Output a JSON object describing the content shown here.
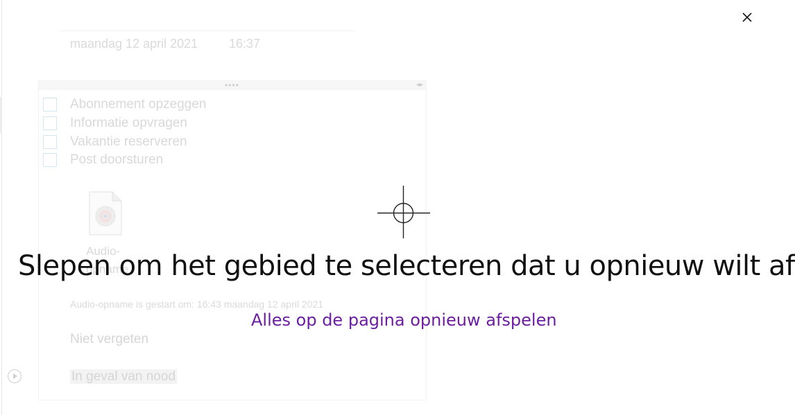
{
  "page": {
    "date": "maandag 12 april 2021",
    "time": "16:37",
    "todo_items": [
      {
        "label": "Abonnement opzeggen"
      },
      {
        "label": "Informatie opvragen"
      },
      {
        "label": "Vakantie reserveren"
      },
      {
        "label": "Post doorsturen"
      }
    ],
    "audio_attachment": {
      "label_line1": "Audio-",
      "label_line2": "opname"
    },
    "audio_info": "Audio-opname is gestart om: 16:43 maandag 12 april 2021",
    "paragraphs": [
      {
        "text": "Niet vergeten"
      },
      {
        "text": "In geval van nood"
      }
    ]
  },
  "overlay": {
    "instruction": "Slepen om het gebied te selecteren dat u opnieuw wilt afspelen",
    "play_all_link": "Alles op de pagina opnieuw afspelen",
    "close_icon": "close-icon",
    "crosshair_icon": "crosshair-icon",
    "link_color": "#6b1fa0"
  }
}
